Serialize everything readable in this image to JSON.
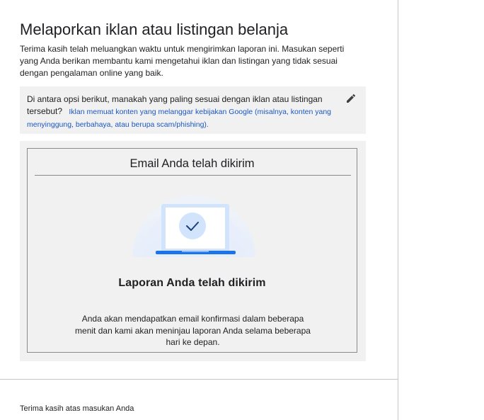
{
  "page": {
    "title": "Melaporkan iklan atau listingan belanja",
    "intro": "Terima kasih telah meluangkan waktu untuk mengirimkan laporan ini. Masukan seperti yang Anda berikan membantu kami mengetahui iklan dan listingan yang tidak sesuai dengan pengalaman online yang baik."
  },
  "question": {
    "prompt": "Di antara opsi berikut, manakah yang paling sesuai dengan iklan atau listingan tersebut?",
    "answer": "Iklan memuat konten yang melanggar kebijakan Google (misalnya, konten yang menyinggung, berbahaya, atau berupa scam/phishing).",
    "edit_icon": "pencil-icon",
    "answer_color": "#1a57c4"
  },
  "confirmation": {
    "heading": "Email Anda telah dikirim",
    "illustration_icon": "laptop-checkmark-icon",
    "title": "Laporan Anda telah dikirim",
    "body": "Anda akan mendapatkan email konfirmasi dalam beberapa menit dan kami akan meninjau laporan Anda selama beberapa hari ke depan.",
    "accent": "#1a73e8"
  },
  "footer": {
    "text": "Terima kasih atas masukan Anda"
  }
}
